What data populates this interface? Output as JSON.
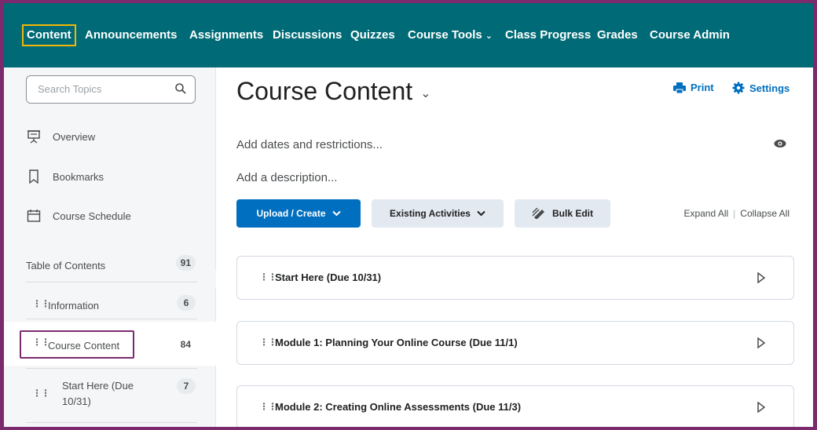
{
  "nav": {
    "items": [
      {
        "label": "Content",
        "active": true
      },
      {
        "label": "Announcements"
      },
      {
        "label": "Assignments"
      },
      {
        "label": "Discussions"
      },
      {
        "label": "Quizzes"
      },
      {
        "label": "Course Tools",
        "dropdown": true
      },
      {
        "label": "Class Progress"
      },
      {
        "label": "Grades"
      },
      {
        "label": "Course Admin"
      }
    ]
  },
  "sidebar": {
    "search_placeholder": "Search Topics",
    "links": [
      {
        "label": "Overview",
        "icon": "presentation-icon"
      },
      {
        "label": "Bookmarks",
        "icon": "bookmark-icon"
      },
      {
        "label": "Course Schedule",
        "icon": "calendar-icon"
      }
    ],
    "toc": {
      "label": "Table of Contents",
      "count": "91"
    },
    "modules": [
      {
        "label": "Information",
        "count": "6"
      },
      {
        "label": "Course Content",
        "count": "84",
        "selected": true
      },
      {
        "label_line1": "Start Here (Due",
        "label_line2": "10/31)",
        "count": "7"
      }
    ]
  },
  "main": {
    "title": "Course Content",
    "print_label": "Print",
    "settings_label": "Settings",
    "add_dates": "Add dates and restrictions...",
    "add_description": "Add a description...",
    "buttons": {
      "upload": "Upload / Create",
      "existing": "Existing Activities",
      "bulk": "Bulk Edit"
    },
    "expand_all": "Expand All",
    "collapse_all": "Collapse All",
    "modules": [
      "Start Here (Due 10/31)",
      "Module 1: Planning Your Online Course (Due 11/1)",
      "Module 2: Creating Online Assessments (Due 11/3)"
    ]
  },
  "colors": {
    "nav_bg": "#006b76",
    "accent": "#006fbf",
    "frame_border": "#7b2a6e",
    "highlight": "#f2b705"
  }
}
